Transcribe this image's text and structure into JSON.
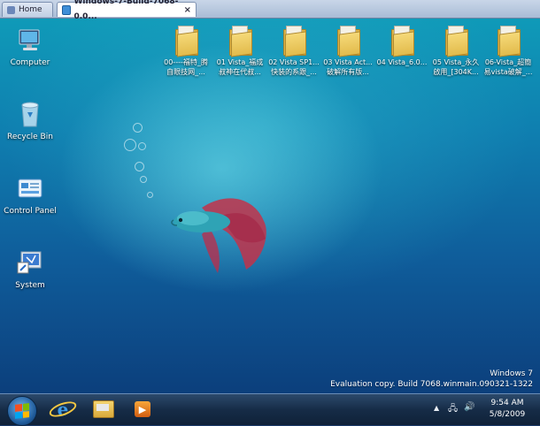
{
  "vm_tabs": [
    {
      "label": "Home"
    },
    {
      "label": "Windows-7-Build-7068-0.0..."
    }
  ],
  "desktop_icons": [
    {
      "label": "Computer"
    },
    {
      "label": "Recycle Bin"
    },
    {
      "label": "Control Panel"
    },
    {
      "label": "System"
    }
  ],
  "folders": [
    {
      "line1": "00----福特_腾",
      "line2": "自眼技网_..."
    },
    {
      "line1": "01 Vista_福成",
      "line2": "叔神在代叔..."
    },
    {
      "line1": "02 Vista SP1...",
      "line2": "快装的系跟_..."
    },
    {
      "line1": "03 Vista Act...",
      "line2": "破解所有版..."
    },
    {
      "line1": "04 Vista_6.0...",
      "line2": ""
    },
    {
      "line1": "05 Vista_永久",
      "line2": "啟用_[304K..."
    },
    {
      "line1": "06-Vista_超簡",
      "line2": "易vista破解_..."
    }
  ],
  "watermark": {
    "line1": "Windows 7",
    "line2": "Evaluation copy. Build 7068.winmain.090321-1322"
  },
  "taskbar": {
    "pinned": [
      "internet-explorer",
      "windows-explorer",
      "media-player"
    ],
    "clock_time": "9:54 AM",
    "clock_date": "5/8/2009",
    "tray_arrow": "▲",
    "tray_network": "🖧",
    "tray_volume": "🔊"
  },
  "media_glyph": "▶"
}
